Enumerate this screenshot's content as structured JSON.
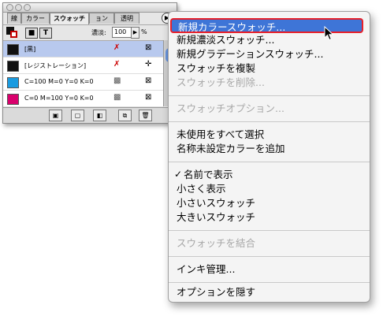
{
  "panel": {
    "tabs": [
      "線",
      "カラー",
      "スウォッチ",
      "ョン",
      "透明"
    ],
    "menu_button_glyph": "▶",
    "format_fill_glyph": "■",
    "format_text_glyph": "T",
    "tint_label": "濃淡:",
    "tint_value": "100",
    "tint_arrow": "▶",
    "tint_unit": "%",
    "swatches": [
      {
        "name": "[黒]",
        "color": "#111111",
        "icon1": "✗",
        "icon2": "⊠"
      },
      {
        "name": "[レジストレーション]",
        "color": "#111111",
        "icon1": "✗",
        "icon2": "✛"
      },
      {
        "name": "C=100 M=0 Y=0 K=0",
        "color": "#1a9be0",
        "icon1": "▩",
        "icon2": "⊠"
      },
      {
        "name": "C=0 M=100 Y=0 K=0",
        "color": "#d9006c",
        "icon1": "▩",
        "icon2": "⊠"
      }
    ],
    "bottom_icons": [
      "show-all-swatches-icon",
      "show-color-swatches-icon",
      "show-gradient-swatches-icon",
      "new-swatch-icon",
      "delete-swatch-icon"
    ]
  },
  "menu": {
    "items": [
      {
        "label": "新規カラースウォッチ...",
        "state": "highlighted"
      },
      {
        "label": "新規濃淡スウォッチ...",
        "state": "enabled"
      },
      {
        "label": "新規グラデーションスウォッチ...",
        "state": "enabled"
      },
      {
        "label": "スウォッチを複製",
        "state": "enabled"
      },
      {
        "label": "スウォッチを削除...",
        "state": "disabled"
      },
      {
        "label": "スウォッチオプション...",
        "state": "disabled"
      },
      {
        "label": "未使用をすべて選択",
        "state": "enabled"
      },
      {
        "label": "名称未設定カラーを追加",
        "state": "enabled"
      },
      {
        "label": "名前で表示",
        "state": "checked"
      },
      {
        "label": "小さく表示",
        "state": "enabled"
      },
      {
        "label": "小さいスウォッチ",
        "state": "enabled"
      },
      {
        "label": "大きいスウォッチ",
        "state": "enabled"
      },
      {
        "label": "スウォッチを結合",
        "state": "disabled"
      },
      {
        "label": "インキ管理...",
        "state": "enabled"
      },
      {
        "label": "オプションを隠す",
        "state": "enabled"
      }
    ],
    "check_glyph": "✓"
  },
  "colors": {
    "highlight": "#3e75d7",
    "highlight_border": "#e8202a",
    "selected_row": "#b8c9ee"
  }
}
